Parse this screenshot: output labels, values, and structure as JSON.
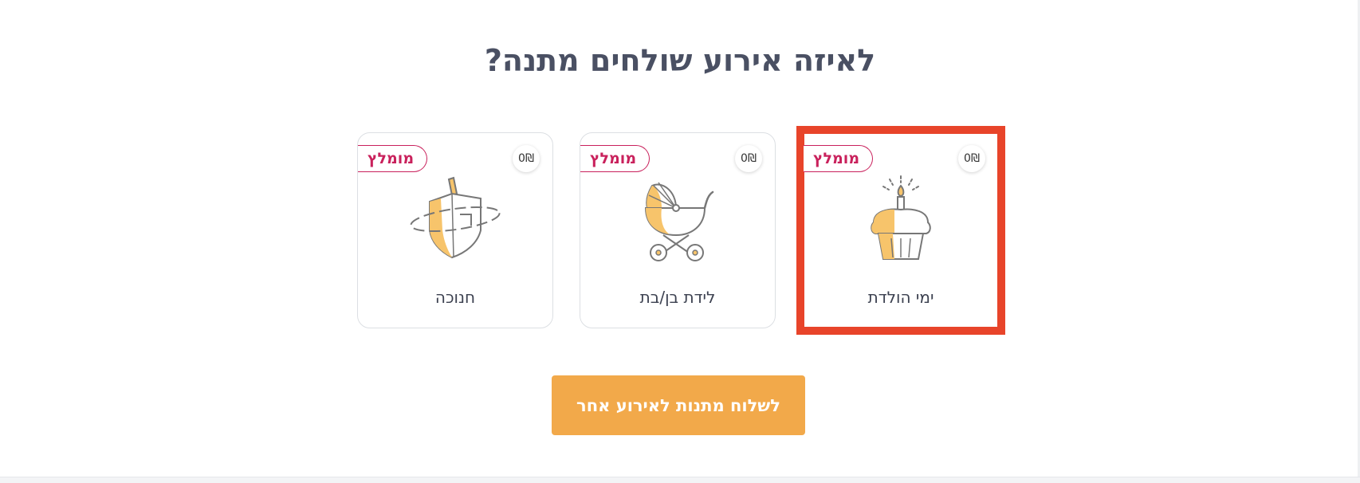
{
  "page": {
    "title": "לאיזה אירוע שולחים מתנה?"
  },
  "cards": [
    {
      "label": "ימי הולדת",
      "badge": "מומלץ",
      "price": "0₪",
      "icon": "birthday-cupcake-icon",
      "selected": true
    },
    {
      "label": "לידת בן/בת",
      "badge": "מומלץ",
      "price": "0₪",
      "icon": "baby-stroller-icon",
      "selected": false
    },
    {
      "label": "חנוכה",
      "badge": "מומלץ",
      "price": "0₪",
      "icon": "dreidel-icon",
      "selected": false
    }
  ],
  "cta": {
    "label": "לשלוח מתנות לאירוע אחר"
  },
  "colors": {
    "title": "#4a5063",
    "badge": "#c9215c",
    "accent": "#f2a94a",
    "selection": "#e8442a",
    "icon_fill": "#f7c46b",
    "icon_stroke": "#777777"
  }
}
